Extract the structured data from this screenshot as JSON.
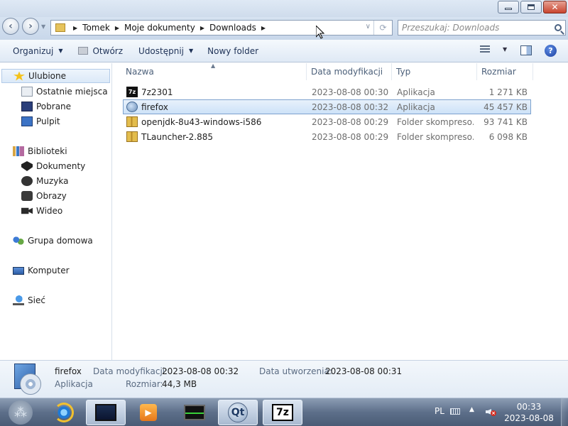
{
  "window": {
    "min_glyph": "",
    "close_glyph": "✕"
  },
  "nav": {
    "back": "‹",
    "forward": "›",
    "history_dd": "▼",
    "breadcrumbs": [
      "Tomek",
      "Moje dokumenty",
      "Downloads"
    ],
    "crumb_sep": "▶",
    "addr_dd": "∨",
    "refresh": "⟳",
    "search_placeholder": "Przeszukaj: Downloads"
  },
  "toolbar": {
    "organize": "Organizuj",
    "open": "Otwórz",
    "share": "Udostępnij",
    "new_folder": "Nowy folder",
    "dd": "▼",
    "help": "?"
  },
  "sidebar": {
    "favorites": "Ulubione",
    "recent": "Ostatnie miejsca",
    "downloads": "Pobrane",
    "desktop": "Pulpit",
    "libraries": "Biblioteki",
    "documents": "Dokumenty",
    "music": "Muzyka",
    "pictures": "Obrazy",
    "videos": "Wideo",
    "homegroup": "Grupa domowa",
    "computer": "Komputer",
    "network": "Sieć"
  },
  "columns": {
    "name": "Nazwa",
    "date": "Data modyfikacji",
    "type": "Typ",
    "size": "Rozmiar",
    "sort_arrow": "▲"
  },
  "files": [
    {
      "name": "7z2301",
      "date": "2023-08-08 00:30",
      "type": "Aplikacja",
      "size": "1 271 KB",
      "icon": "7z-icon",
      "icon_text": "7z"
    },
    {
      "name": "firefox",
      "date": "2023-08-08 00:32",
      "type": "Aplikacja",
      "size": "45 457 KB",
      "icon": "firefox-setup-icon",
      "icon_text": ""
    },
    {
      "name": "openjdk-8u43-windows-i586",
      "date": "2023-08-08 00:29",
      "type": "Folder skompreso...",
      "size": "93 741 KB",
      "icon": "zip-folder-icon",
      "icon_text": ""
    },
    {
      "name": "TLauncher-2.885",
      "date": "2023-08-08 00:29",
      "type": "Folder skompreso...",
      "size": "6 098 KB",
      "icon": "zip-folder-icon",
      "icon_text": ""
    }
  ],
  "details": {
    "name": "firefox",
    "type": "Aplikacja",
    "modified_label": "Data modyfikacji:",
    "modified_value": "2023-08-08 00:32",
    "created_label": "Data utworzenia:",
    "created_value": "2023-08-08 00:31",
    "size_label": "Rozmiar:",
    "size_value": "44,3 MB"
  },
  "taskbar": {
    "start_glyph": "⁂",
    "media_glyph": "▶",
    "qt_glyph": "Qt",
    "sevenzip_glyph": "7z",
    "lang": "PL",
    "tray_arrow": "▲",
    "time": "00:33",
    "date": "2023-08-08"
  },
  "colors": {
    "selection": "#cde2f8",
    "selection_border": "#7da2ce",
    "header_text": "#4c607a",
    "secondary_text": "#6d6d6d",
    "taskbar": "#5d6f8a"
  }
}
